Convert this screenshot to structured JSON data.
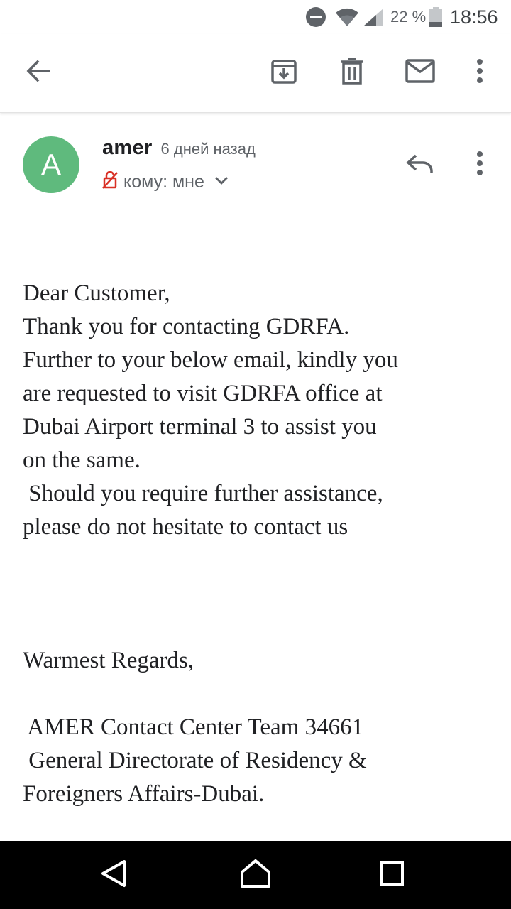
{
  "status_bar": {
    "battery_text": "22 %",
    "time": "18:56",
    "icons": [
      "do-not-disturb-icon",
      "wifi-icon",
      "signal-icon",
      "battery-icon"
    ]
  },
  "toolbar": {
    "icons": [
      "back-arrow-icon",
      "archive-icon",
      "delete-icon",
      "mark-unread-icon",
      "more-vert-icon"
    ]
  },
  "message_header": {
    "avatar_letter": "A",
    "avatar_color": "#5fba7d",
    "sender_name": "amer",
    "time_ago": "6 дней назад",
    "recipient": "кому: мне",
    "icons": [
      "encryption-off-icon",
      "chevron-down-icon",
      "reply-icon",
      "more-vert-icon"
    ]
  },
  "message_body": {
    "greeting": "Dear Customer,",
    "paragraph_lines": [
      "Thank you for contacting GDRFA.",
      "Further to your below email, kindly you",
      "are requested to visit GDRFA office at",
      "Dubai Airport terminal 3 to assist you",
      "on the same.",
      " Should you require further assistance,",
      "please do not hesitate to contact us"
    ],
    "closing": "Warmest Regards,",
    "signature_lines": [
      " AMER Contact Center Team 34661",
      " General Directorate of Residency &",
      "Foreigners Affairs-Dubai."
    ]
  },
  "nav_bar": {
    "icons": [
      "back-triangle-icon",
      "home-icon",
      "recents-icon"
    ]
  }
}
